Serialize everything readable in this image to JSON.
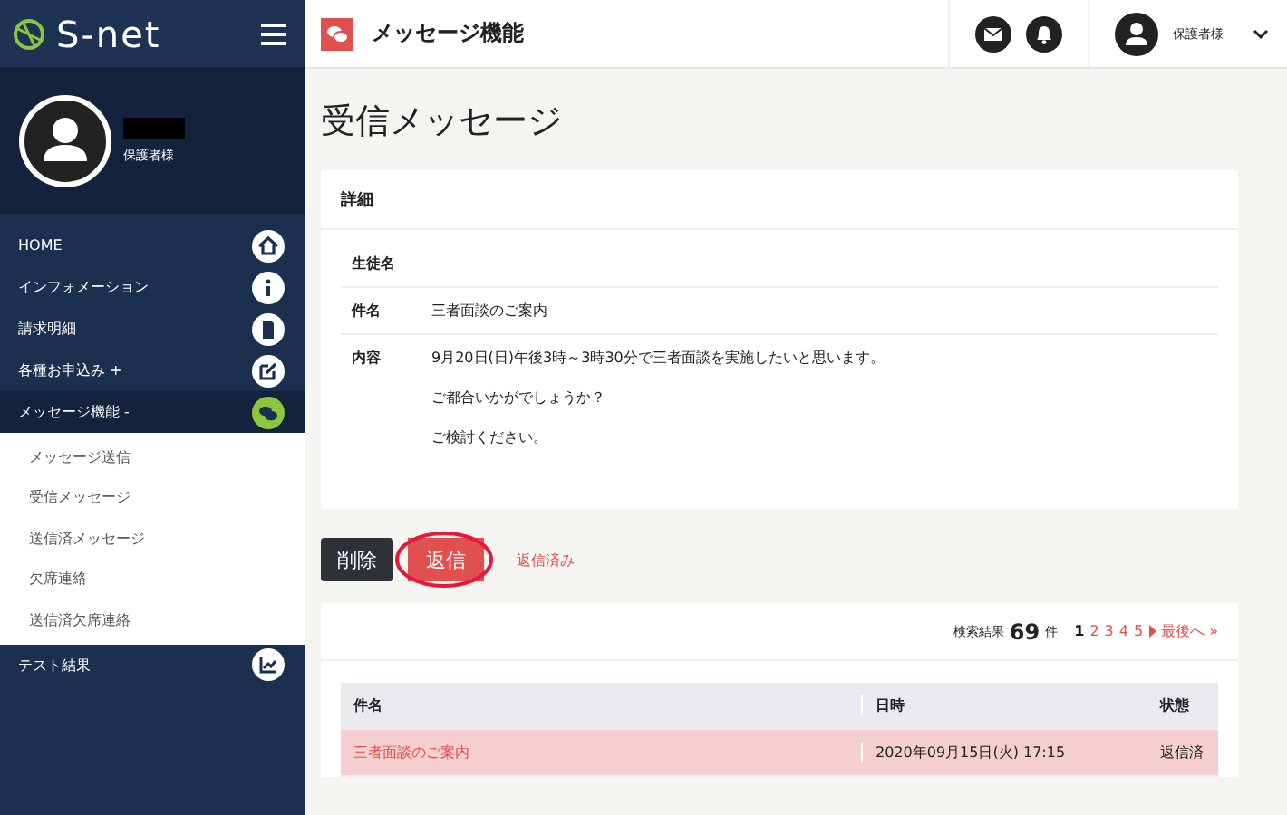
{
  "sidebar": {
    "logo": "S-net",
    "user_role": "保護者様",
    "items": [
      {
        "label": "HOME",
        "selected": false
      },
      {
        "label": "インフォメーション",
        "selected": false
      },
      {
        "label": "請求明細",
        "selected": false
      },
      {
        "label": "各種お申込み +",
        "selected": false
      },
      {
        "label": "メッセージ機能 -",
        "selected": true,
        "children": [
          {
            "label": "メッセージ送信"
          },
          {
            "label": "受信メッセージ"
          },
          {
            "label": "送信済メッセージ"
          },
          {
            "label": "欠席連絡"
          },
          {
            "label": "送信済欠席連絡"
          }
        ]
      },
      {
        "label": "テスト結果",
        "selected": false
      }
    ]
  },
  "header": {
    "title": "メッセージ機能",
    "user_role": "保護者様"
  },
  "page_title": "受信メッセージ",
  "detail": {
    "title": "詳細",
    "rows": [
      {
        "label": "生徒名",
        "paragraphs": []
      },
      {
        "label": "件名",
        "paragraphs": [
          "三者面談のご案内"
        ]
      },
      {
        "label": "内容",
        "paragraphs": [
          "9月20日(日)午後3時～3時30分で三者面談を実施したいと思います。",
          "ご都合いかがでしょうか？",
          "ご検討ください。"
        ]
      }
    ]
  },
  "actions": {
    "delete": "削除",
    "reply": "返信",
    "reply_highlighted": true,
    "status": "返信済み"
  },
  "results": {
    "label": "検索結果",
    "count": "69",
    "unit": "件",
    "pages": [
      {
        "label": "1",
        "selected": true
      },
      {
        "label": "2",
        "selected": false
      },
      {
        "label": "3",
        "selected": false
      },
      {
        "label": "4",
        "selected": false
      },
      {
        "label": "5",
        "selected": false
      }
    ],
    "last": "最後へ »",
    "columns": [
      "件名",
      "日時",
      "状態"
    ],
    "rows": [
      {
        "subject": "三者面談のご案内",
        "date": "2020年09月15日(火) 17:15",
        "status": "返信済",
        "selected": true
      }
    ]
  }
}
